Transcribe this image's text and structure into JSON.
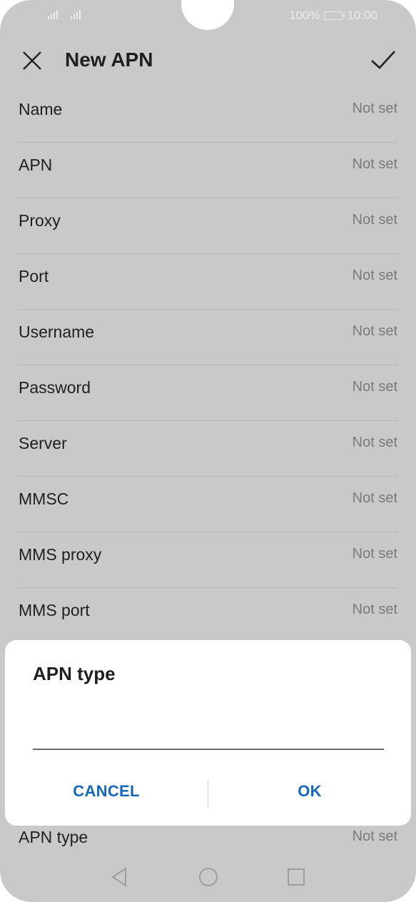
{
  "status_bar": {
    "battery_percent": "100%",
    "time": "10:00"
  },
  "app_bar": {
    "title": "New APN",
    "close_icon": "close-icon",
    "save_icon": "check-icon"
  },
  "fields": [
    {
      "label": "Name",
      "value": "Not set"
    },
    {
      "label": "APN",
      "value": "Not set"
    },
    {
      "label": "Proxy",
      "value": "Not set"
    },
    {
      "label": "Port",
      "value": "Not set"
    },
    {
      "label": "Username",
      "value": "Not set"
    },
    {
      "label": "Password",
      "value": "Not set"
    },
    {
      "label": "Server",
      "value": "Not set"
    },
    {
      "label": "MMSC",
      "value": "Not set"
    },
    {
      "label": "MMS proxy",
      "value": "Not set"
    },
    {
      "label": "MMS port",
      "value": "Not set"
    },
    {
      "label": "APN type",
      "value": "Not set"
    }
  ],
  "dialog": {
    "title": "APN type",
    "input_value": "",
    "cancel_label": "CANCEL",
    "ok_label": "OK",
    "accent_color": "#1667b8"
  },
  "nav_bar": {
    "back_icon": "back-icon",
    "home_icon": "home-icon",
    "recents_icon": "recents-icon"
  }
}
